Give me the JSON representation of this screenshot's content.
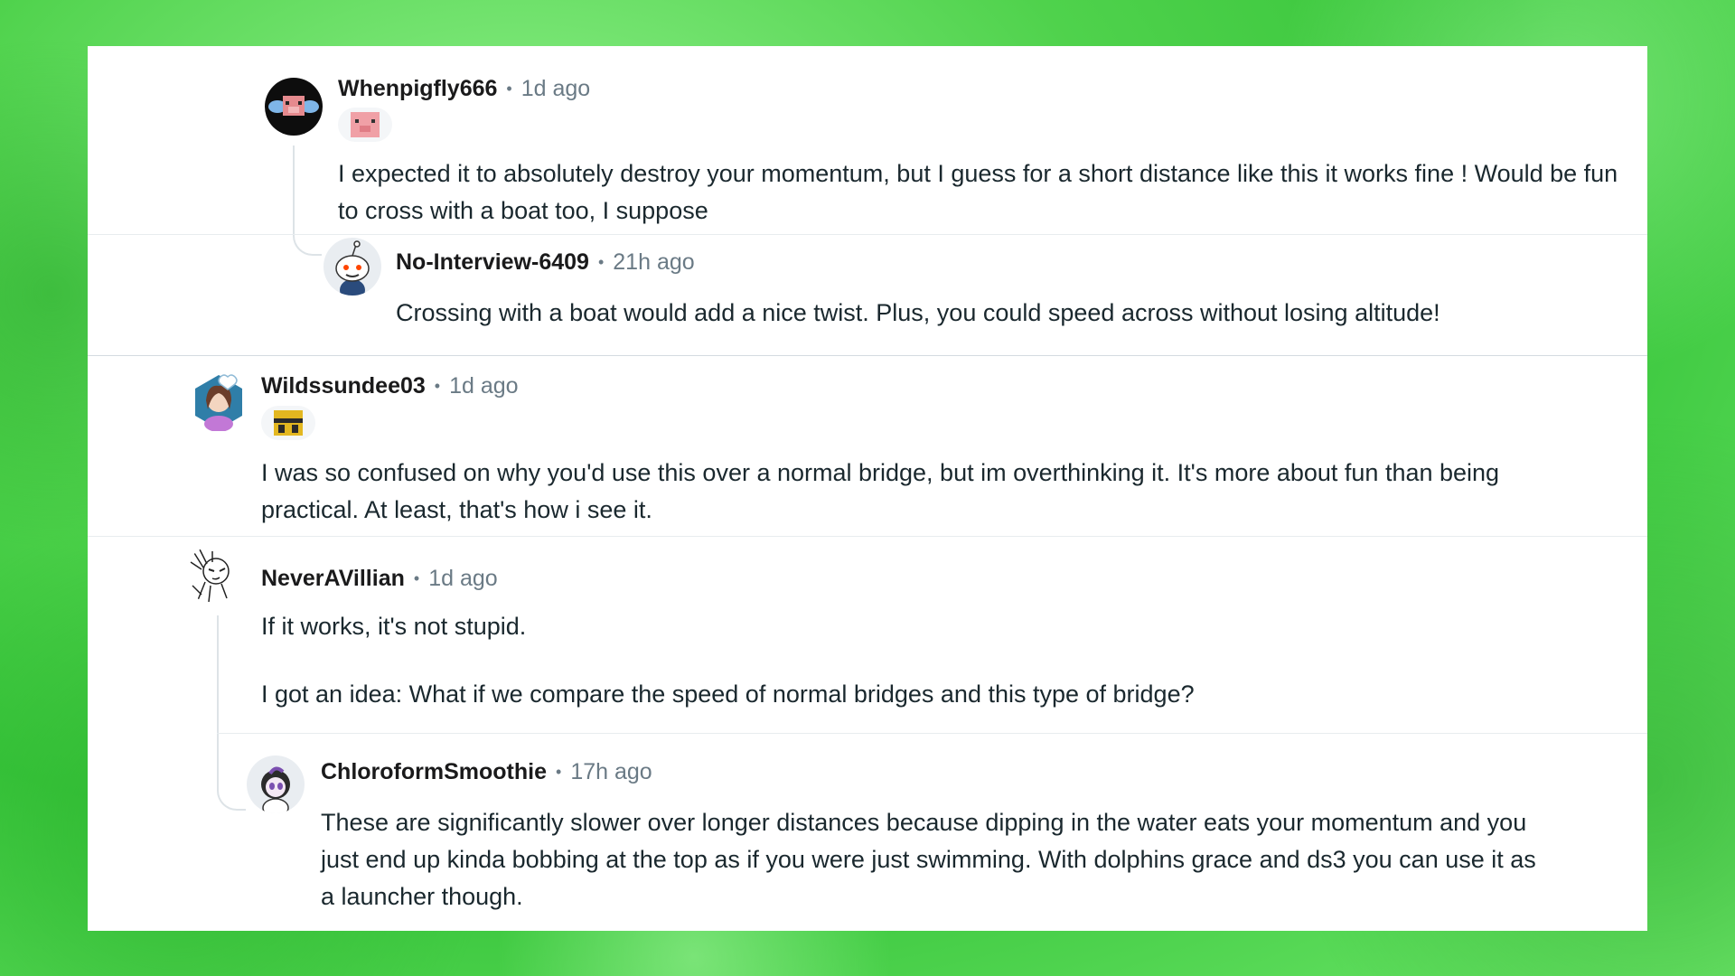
{
  "comments": [
    {
      "username": "Whenpigfly666",
      "time": "1d ago",
      "flair_icon": "pig-face-icon",
      "body": "I expected it to absolutely destroy your momentum, but I guess for a short distance like this it works fine ! Would be fun to cross with a boat too, I suppose",
      "avatar_icon": "winged-pig-avatar"
    },
    {
      "username": "No-Interview-6409",
      "time": "21h ago",
      "body": "Crossing with a boat would add a nice twist. Plus, you could speed across without losing altitude!",
      "avatar_icon": "snoo-avatar"
    },
    {
      "username": "Wildssundee03",
      "time": "1d ago",
      "flair_icon": "bee-face-icon",
      "body": "I was so confused on why you'd use this over a normal bridge, but im overthinking it. It's more about fun than being practical. At least, that's how i see it.",
      "avatar_icon": "hexagon-girl-avatar"
    },
    {
      "username": "NeverAVillian",
      "time": "1d ago",
      "body_paragraphs": [
        "If it works, it's not stupid.",
        "I got an idea: What if we compare the speed of normal bridges and this type of bridge?"
      ],
      "avatar_icon": "sketch-avatar"
    },
    {
      "username": "ChloroformSmoothie",
      "time": "17h ago",
      "body": "These are significantly slower over longer distances because dipping in the water eats your momentum and you just end up kinda bobbing at the top as if you were just swimming. With dolphins grace and ds3 you can use it as a launcher though.",
      "avatar_icon": "purple-hair-avatar"
    }
  ],
  "separator": "•",
  "colors": {
    "background": "#4fd24c",
    "panel": "#ffffff",
    "username": "#1a1a1b",
    "meta": "#6a7a85",
    "body": "#1a282e"
  }
}
